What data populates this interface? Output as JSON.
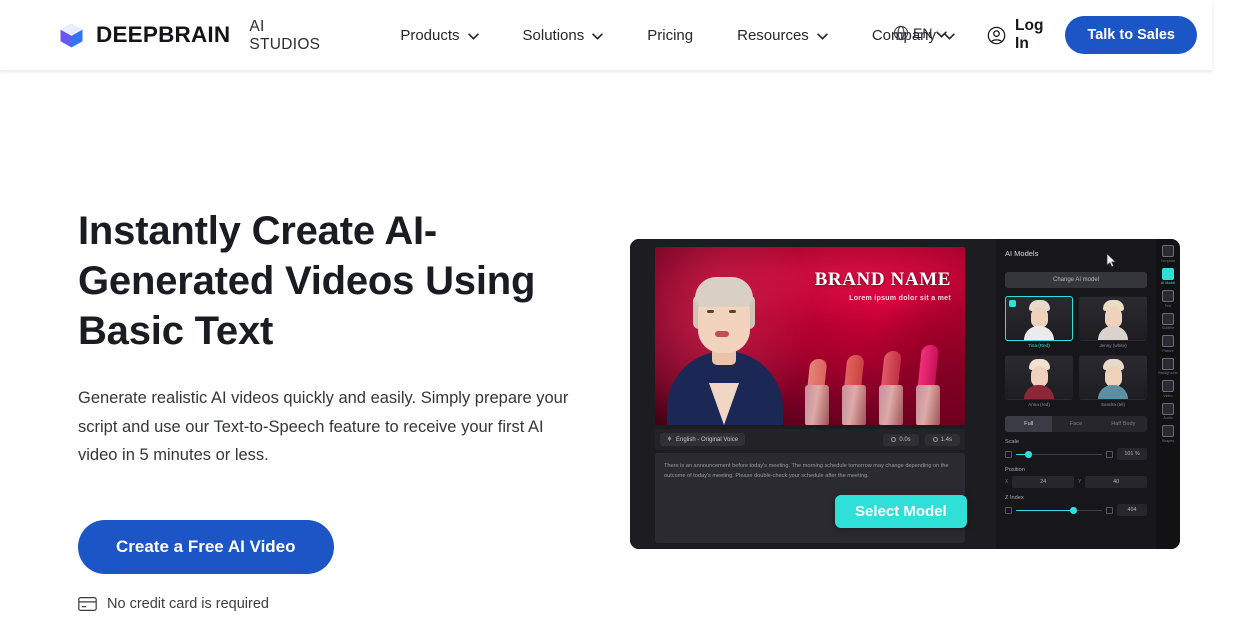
{
  "header": {
    "brand": {
      "name": "DEEPBRAIN",
      "sub": "AI STUDIOS",
      "logo_icon": "cube-logo-icon"
    },
    "nav": [
      {
        "label": "Products",
        "has_dropdown": true
      },
      {
        "label": "Solutions",
        "has_dropdown": true
      },
      {
        "label": "Pricing",
        "has_dropdown": false
      },
      {
        "label": "Resources",
        "has_dropdown": true
      },
      {
        "label": "Company",
        "has_dropdown": true
      }
    ],
    "language": {
      "label": "EN",
      "icon": "globe-icon"
    },
    "login": {
      "label": "Log In",
      "icon": "user-circle-icon"
    },
    "cta": {
      "label": "Talk to Sales",
      "color": "#1b55c6"
    }
  },
  "hero": {
    "title": "Instantly Create AI-Generated Videos Using Basic Text",
    "subtitle": "Generate realistic AI videos quickly and easily. Simply prepare your script and use our Text-to-Speech feature to receive your first AI video in 5 minutes or less.",
    "cta_label": "Create a Free AI Video",
    "note": "No credit card is required",
    "note_icon": "credit-card-icon"
  },
  "app": {
    "stage": {
      "brand_name": "BRAND NAME",
      "brand_tagline": "Lorem ipsum dolor sit a met"
    },
    "toolbar": {
      "language_chip": "English - Original Voice",
      "chip_icon": "voice-icon",
      "pill_1": "0.0s",
      "pill_2": "1.4s"
    },
    "script": "There is an announcement before today's meeting. The morning schedule tomorrow may change depending on the outcome of today's meeting. Please double-check your schedule after the meeting.",
    "select_button": "Select Model",
    "select_button_color": "#2ee0d7",
    "panel": {
      "title": "AI Models",
      "change_button": "Change AI model",
      "models": [
        {
          "name": "Tina (Red)",
          "selected": true,
          "hair": "#e4dbcd",
          "shoulder": "#eceaea"
        },
        {
          "name": "Jenny (white)",
          "selected": false,
          "hair": "#e9ddc6",
          "shoulder": "#d9d3cc"
        },
        {
          "name": "Anna (red)",
          "selected": false,
          "hair": "#efe3cd",
          "shoulder": "#8e2638"
        },
        {
          "name": "Sandra (tel)",
          "selected": false,
          "hair": "#e6dbc8",
          "shoulder": "#5b8fa3"
        }
      ],
      "segments": [
        {
          "label": "Full",
          "active": true
        },
        {
          "label": "Face",
          "active": false
        },
        {
          "label": "Half Body",
          "active": false
        }
      ],
      "controls": [
        {
          "label": "Scale",
          "value": "101 %",
          "fill_pct": 13
        },
        {
          "label": "Position",
          "x": "24",
          "y": "40",
          "x_tag": "X",
          "y_tag": "Y"
        },
        {
          "label": "Z Index",
          "value": "404",
          "fill_pct": 66
        }
      ]
    },
    "rail": [
      {
        "label": "Template",
        "active": false
      },
      {
        "label": "AI Model",
        "active": true
      },
      {
        "label": "Text",
        "active": false
      },
      {
        "label": "Subtitle",
        "active": false
      },
      {
        "label": "Picture",
        "active": false
      },
      {
        "label": "Background",
        "active": false
      },
      {
        "label": "Video",
        "active": false
      },
      {
        "label": "Audio",
        "active": false
      },
      {
        "label": "Shapes",
        "active": false
      }
    ]
  }
}
